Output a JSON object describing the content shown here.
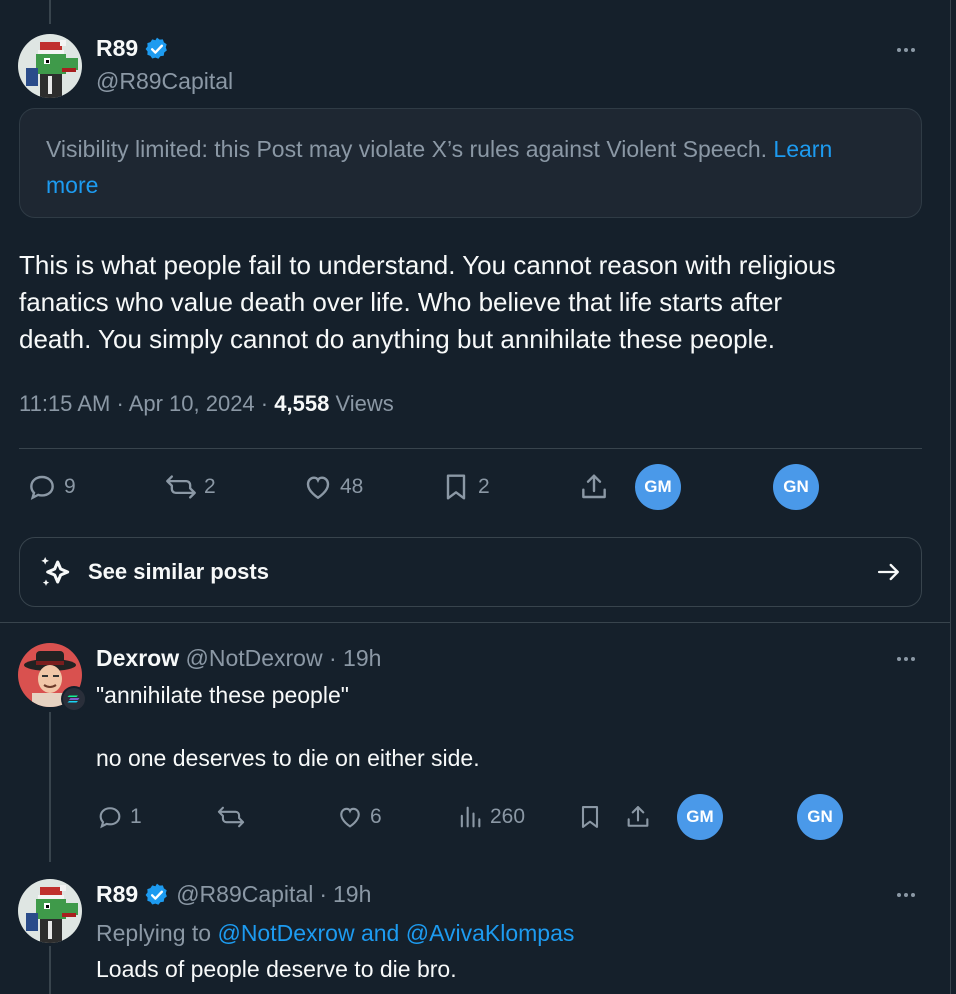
{
  "main_post": {
    "display_name": "R89",
    "handle": "@R89Capital",
    "notice_text": "Visibility limited: this Post may violate X’s rules against Violent Speech.",
    "notice_link_1": "Learn",
    "notice_link_2": "more",
    "body_line_1": "This is what people fail to understand. You cannot reason with religious",
    "body_line_2": "fanatics who value death over life. Who believe that life starts after",
    "body_line_3": "death. You simply cannot do anything but annihilate these people.",
    "time": "11:15 AM",
    "dot": "·",
    "date": "Apr 10, 2024",
    "views_count": "4,558",
    "views_label": "Views",
    "actions": {
      "replies": "9",
      "reposts": "2",
      "likes": "48",
      "bookmarks": "2"
    },
    "gm_label": "GM",
    "gn_label": "GN",
    "similar_label": "See similar posts"
  },
  "reply_1": {
    "display_name": "Dexrow",
    "handle": "@NotDexrow",
    "dot": "·",
    "age": "19h",
    "line_1": "\"annihilate these people\"",
    "line_2": "no one deserves to die on either side.",
    "actions": {
      "replies": "1",
      "reposts": "",
      "likes": "6",
      "views": "260"
    },
    "gm_label": "GM",
    "gn_label": "GN"
  },
  "reply_2": {
    "display_name": "R89",
    "handle": "@R89Capital",
    "dot": "·",
    "age": "19h",
    "replying_prefix": "Replying to",
    "replying_targets": "@NotDexrow and @AvivaKlompas",
    "text": "Loads of people deserve to die bro."
  },
  "colors": {
    "background": "#15202b",
    "accent": "#1d9bf0",
    "pill": "#4a99e9",
    "muted": "#8b98a5",
    "border": "#38444d"
  }
}
